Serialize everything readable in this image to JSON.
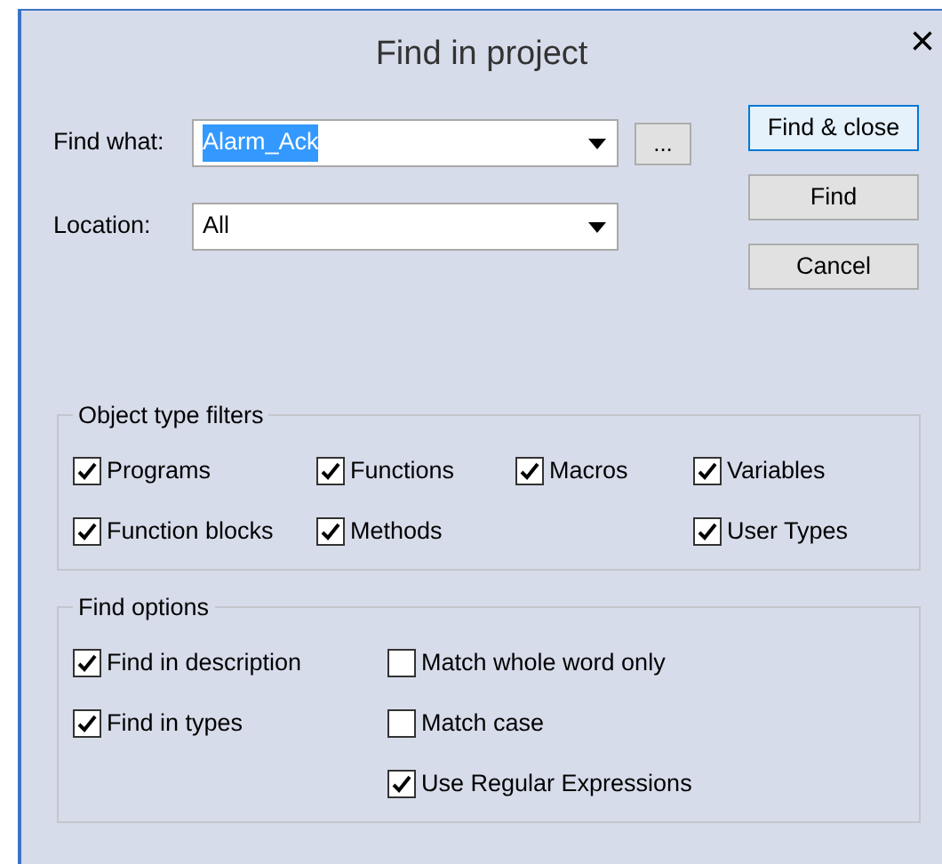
{
  "window": {
    "title": "Find in project",
    "close": "×"
  },
  "find_what": {
    "label": "Find what:",
    "value": "Alarm_Ack",
    "text_selected": true,
    "browse": "..."
  },
  "location": {
    "label": "Location:",
    "value": "All"
  },
  "buttons": [
    {
      "label": "Find & close",
      "default": true
    },
    {
      "label": "Find",
      "default": false
    },
    {
      "label": "Cancel",
      "default": false
    }
  ],
  "groups": [
    {
      "title": "Object type filters",
      "columns": [
        [
          {
            "label": "Programs",
            "checked": true
          },
          {
            "label": "Function blocks",
            "checked": true
          }
        ],
        [
          {
            "label": "Functions",
            "checked": true
          },
          {
            "label": "Methods",
            "checked": true
          }
        ],
        [
          {
            "label": "Macros",
            "checked": true
          }
        ],
        [
          {
            "label": "Variables",
            "checked": true
          },
          {
            "label": "User Types",
            "checked": true
          }
        ]
      ]
    },
    {
      "title": "Find options",
      "columns": [
        [
          {
            "label": "Find in description",
            "checked": true
          },
          {
            "label": "Find in types",
            "checked": true
          }
        ],
        [
          {
            "label": "Match whole word only",
            "checked": false
          },
          {
            "label": "Match case",
            "checked": false
          },
          {
            "label": "Use Regular Expressions",
            "checked": true
          }
        ]
      ]
    }
  ]
}
